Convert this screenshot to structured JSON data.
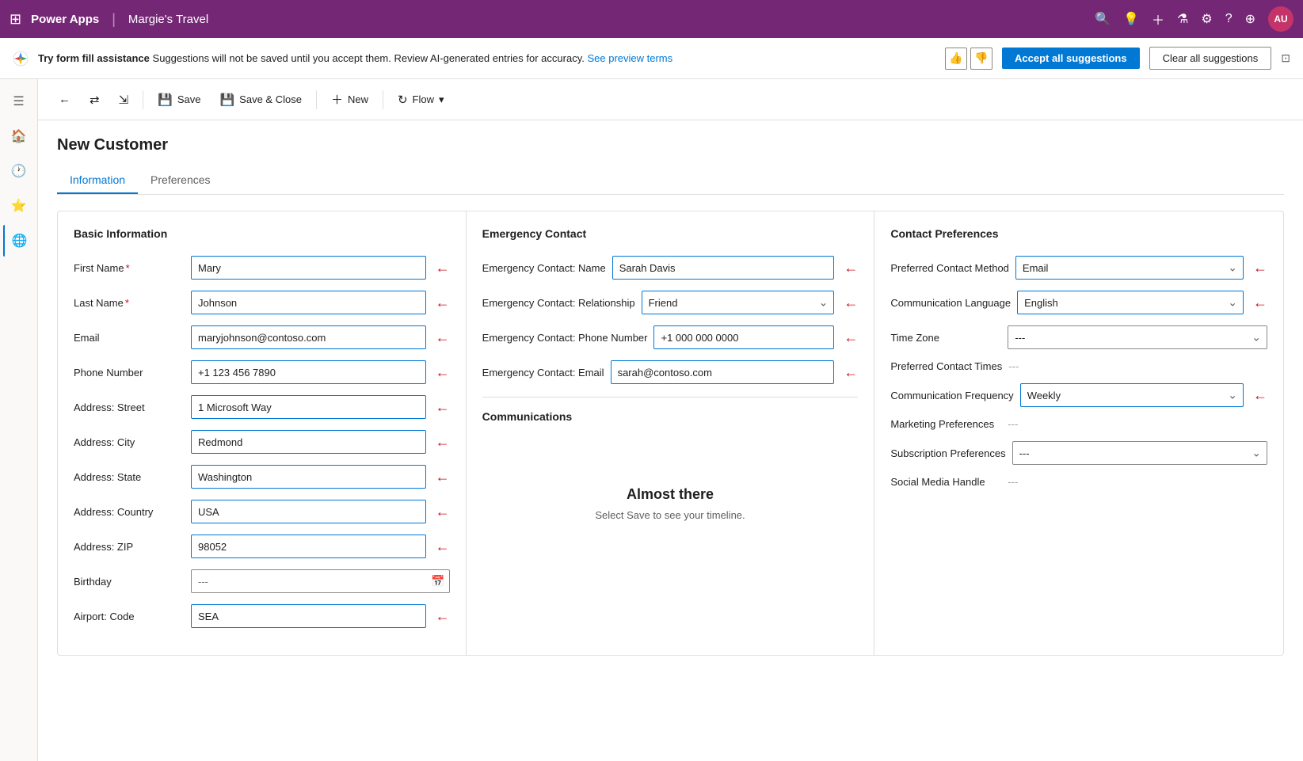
{
  "topNav": {
    "waffle": "⊞",
    "appName": "Power Apps",
    "separator": "|",
    "appTitle": "Margie's Travel",
    "icons": [
      "🔍",
      "💡",
      "+",
      "▼",
      "⚙",
      "?",
      "⊕"
    ],
    "avatarLabel": "AU"
  },
  "suggestionBar": {
    "boldText": "Try form fill assistance",
    "mainText": " Suggestions will not be saved until you accept them. Review AI-generated entries for accuracy. ",
    "linkText": "See preview terms",
    "thumbUp": "👍",
    "thumbDown": "👎",
    "acceptLabel": "Accept all suggestions",
    "clearLabel": "Clear all suggestions"
  },
  "toolbar": {
    "backLabel": "←",
    "icon1": "⇄",
    "icon2": "⇲",
    "saveLabel": "Save",
    "saveCloseLabel": "Save & Close",
    "newLabel": "New",
    "flowLabel": "Flow",
    "flowDropdown": "▾"
  },
  "form": {
    "title": "New Customer",
    "tabs": [
      "Information",
      "Preferences"
    ],
    "activeTab": 0
  },
  "basicInfo": {
    "sectionTitle": "Basic Information",
    "fields": [
      {
        "label": "First Name",
        "required": true,
        "value": "Mary",
        "type": "input",
        "highlighted": true
      },
      {
        "label": "Last Name",
        "required": true,
        "value": "Johnson",
        "type": "input",
        "highlighted": true
      },
      {
        "label": "Email",
        "required": false,
        "value": "maryjohnson@contoso.com",
        "type": "input",
        "highlighted": true
      },
      {
        "label": "Phone Number",
        "required": false,
        "value": "+1 123 456 7890",
        "type": "input",
        "highlighted": true
      },
      {
        "label": "Address: Street",
        "required": false,
        "value": "1 Microsoft Way",
        "type": "input",
        "highlighted": true
      },
      {
        "label": "Address: City",
        "required": false,
        "value": "Redmond",
        "type": "input",
        "highlighted": true
      },
      {
        "label": "Address: State",
        "required": false,
        "value": "Washington",
        "type": "input",
        "highlighted": true
      },
      {
        "label": "Address: Country",
        "required": false,
        "value": "USA",
        "type": "input",
        "highlighted": true
      },
      {
        "label": "Address: ZIP",
        "required": false,
        "value": "98052",
        "type": "input",
        "highlighted": true
      },
      {
        "label": "Birthday",
        "required": false,
        "value": "---",
        "type": "date",
        "highlighted": false
      },
      {
        "label": "Airport: Code",
        "required": false,
        "value": "SEA",
        "type": "input",
        "highlighted": true
      }
    ]
  },
  "emergencyContact": {
    "sectionTitle": "Emergency Contact",
    "fields": [
      {
        "label": "Emergency Contact: Name",
        "value": "Sarah Davis",
        "type": "input",
        "highlighted": true
      },
      {
        "label": "Emergency Contact: Relationship",
        "value": "Friend",
        "type": "select",
        "highlighted": true
      },
      {
        "label": "Emergency Contact: Phone Number",
        "value": "+1 000 000 0000",
        "type": "input",
        "highlighted": true
      },
      {
        "label": "Emergency Contact: Email",
        "value": "sarah@contoso.com",
        "type": "input",
        "highlighted": true
      }
    ],
    "communications": {
      "sectionTitle": "Communications",
      "almostThereTitle": "Almost there",
      "almostThereText": "Select Save to see your timeline."
    }
  },
  "contactPreferences": {
    "sectionTitle": "Contact Preferences",
    "fields": [
      {
        "label": "Preferred Contact Method",
        "value": "Email",
        "type": "select",
        "highlighted": true
      },
      {
        "label": "Communication Language",
        "value": "English",
        "type": "select",
        "highlighted": true
      },
      {
        "label": "Time Zone",
        "value": "---",
        "type": "select",
        "highlighted": false
      },
      {
        "label": "Preferred Contact Times",
        "value": "---",
        "type": "text",
        "highlighted": false
      },
      {
        "label": "Communication Frequency",
        "value": "Weekly",
        "type": "select",
        "highlighted": true
      },
      {
        "label": "Marketing Preferences",
        "value": "---",
        "type": "text",
        "highlighted": false
      },
      {
        "label": "Subscription Preferences",
        "value": "---",
        "type": "select",
        "highlighted": false
      },
      {
        "label": "Social Media Handle",
        "value": "---",
        "type": "text",
        "highlighted": false
      }
    ]
  },
  "sidebar": {
    "icons": [
      "☰",
      "🏠",
      "🕐",
      "⭐",
      "🌐"
    ]
  }
}
